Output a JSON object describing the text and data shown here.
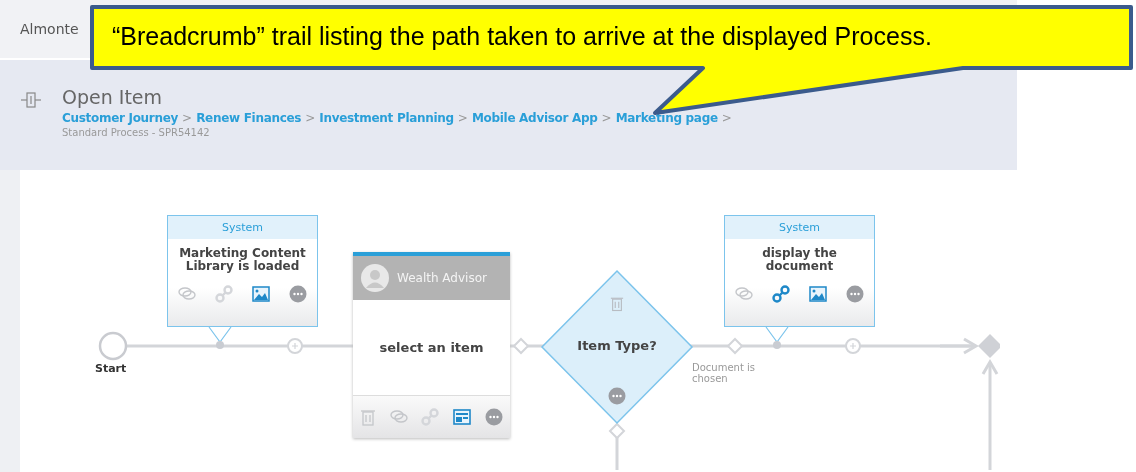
{
  "top_bar": {
    "text": "Almonte"
  },
  "header": {
    "title": "Open Item",
    "separator": ">",
    "breadcrumbs": [
      "Customer Journey",
      "Renew Finances",
      "Investment Planning",
      "Mobile Advisor App",
      "Marketing page"
    ],
    "subtitle": "Standard Process - SPR54142"
  },
  "diagram": {
    "nodes": [
      {
        "kind": "start",
        "label": "Start"
      },
      {
        "kind": "system",
        "header": "System",
        "label": "Marketing Content Library is loaded",
        "icons": [
          {
            "kind": "comment",
            "active": false
          },
          {
            "kind": "link",
            "active": false
          },
          {
            "kind": "image",
            "active": true
          },
          {
            "kind": "more",
            "active": true
          }
        ]
      },
      {
        "kind": "user",
        "header": "Wealth Advisor",
        "label": "select an item",
        "icons": [
          {
            "kind": "trash",
            "active": false
          },
          {
            "kind": "comment",
            "active": false
          },
          {
            "kind": "link",
            "active": false
          },
          {
            "kind": "form",
            "active": true
          },
          {
            "kind": "more",
            "active": true
          }
        ]
      },
      {
        "kind": "decision",
        "label": "Item Type?"
      },
      {
        "kind": "connector",
        "label": "Document is chosen"
      },
      {
        "kind": "system",
        "header": "System",
        "label": "display the document",
        "icons": [
          {
            "kind": "comment",
            "active": false
          },
          {
            "kind": "link",
            "active": true
          },
          {
            "kind": "image",
            "active": true
          },
          {
            "kind": "more",
            "active": true
          }
        ]
      }
    ]
  },
  "callout": {
    "text": "“Breadcrumb” trail listing the path taken to arrive at the displayed Process."
  }
}
